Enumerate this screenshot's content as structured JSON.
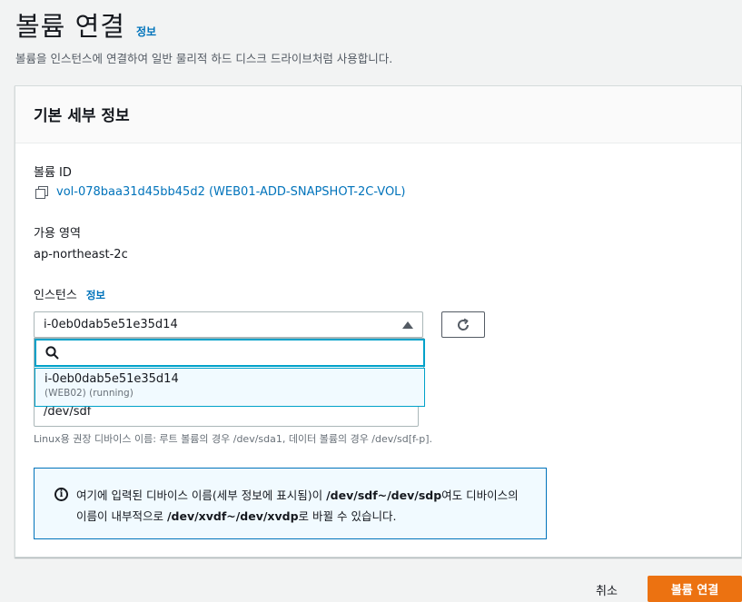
{
  "page": {
    "title": "볼륨 연결",
    "info_label": "정보",
    "description": "볼륨을 인스턴스에 연결하여 일반 물리적 하드 디스크 드라이브처럼 사용합니다."
  },
  "panel": {
    "title": "기본 세부 정보",
    "volume_id_label": "볼륨 ID",
    "volume_id_value": "vol-078baa31d45bb45d2 (WEB01-ADD-SNAPSHOT-2C-VOL)",
    "az_label": "가용 영역",
    "az_value": "ap-northeast-2c",
    "instance_label": "인스턴스",
    "instance_info": "정보",
    "instance_selected": "i-0eb0dab5e51e35d14",
    "search_placeholder": "",
    "option_main": "i-0eb0dab5e51e35d14",
    "option_sub": "(WEB02) (running)",
    "device_value": "/dev/sdf",
    "device_hint": "Linux용 권장 디바이스 이름: 루트 볼륨의 경우 /dev/sda1, 데이터 볼륨의 경우 /dev/sd[f-p]."
  },
  "alert": {
    "text_1": "여기에 입력된 디바이스 이름(세부 정보에 표시됨)이 ",
    "bold_1": "/dev/sdf~/dev/sdp",
    "text_2": "여도 디바이스의 이름이 내부적으로 ",
    "bold_2": "/dev/xvdf~/dev/xvdp",
    "text_3": "로 바뀔 수 있습니다.",
    "icon": "info-circle-icon"
  },
  "footer": {
    "cancel_label": "취소",
    "submit_label": "볼륨 연결"
  },
  "colors": {
    "accent": "#ec7211",
    "link": "#0073bb",
    "focus": "#00a1c9"
  }
}
